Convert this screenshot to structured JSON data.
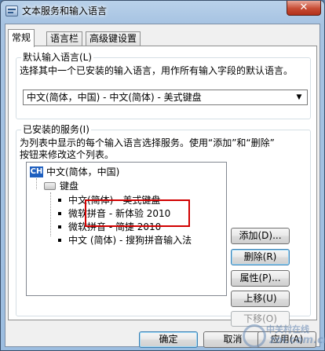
{
  "window": {
    "title": "文本服务和输入语言",
    "close_label": "✕"
  },
  "tabs": [
    {
      "label": "常规"
    },
    {
      "label": "语言栏"
    },
    {
      "label": "高级键设置"
    }
  ],
  "default_language": {
    "legend": "默认输入语言(L)",
    "description": "选择其中一个已安装的输入语言，用作所有输入字段的默认语言。",
    "selected": "中文(简体，中国) - 中文(简体) - 美式键盘"
  },
  "installed_services": {
    "legend": "已安装的服务(I)",
    "description_line1": "为列表中显示的每个输入语言选择服务。使用“添加”和“删除”",
    "description_line2": "按钮来修改这个列表。",
    "tree": {
      "language_badge": "CH",
      "language": "中文(简体，中国)",
      "keyboard_group": "键盘",
      "items": [
        "中文(简体) - 美式键盘",
        "微软拼音 - 新体验 2010",
        "微软拼音 - 简捷 2010",
        "中文 (简体) - 搜狗拼音输入法"
      ]
    },
    "buttons": {
      "add": "添加(D)...",
      "remove": "删除(R)",
      "properties": "属性(P)...",
      "move_up": "上移(U)",
      "move_down": "下移(O)"
    }
  },
  "footer": {
    "ok": "确定",
    "cancel": "取消",
    "apply": "应用(A)"
  },
  "watermark": {
    "text": "中关村在线",
    "sub": "zol.com.cn"
  }
}
